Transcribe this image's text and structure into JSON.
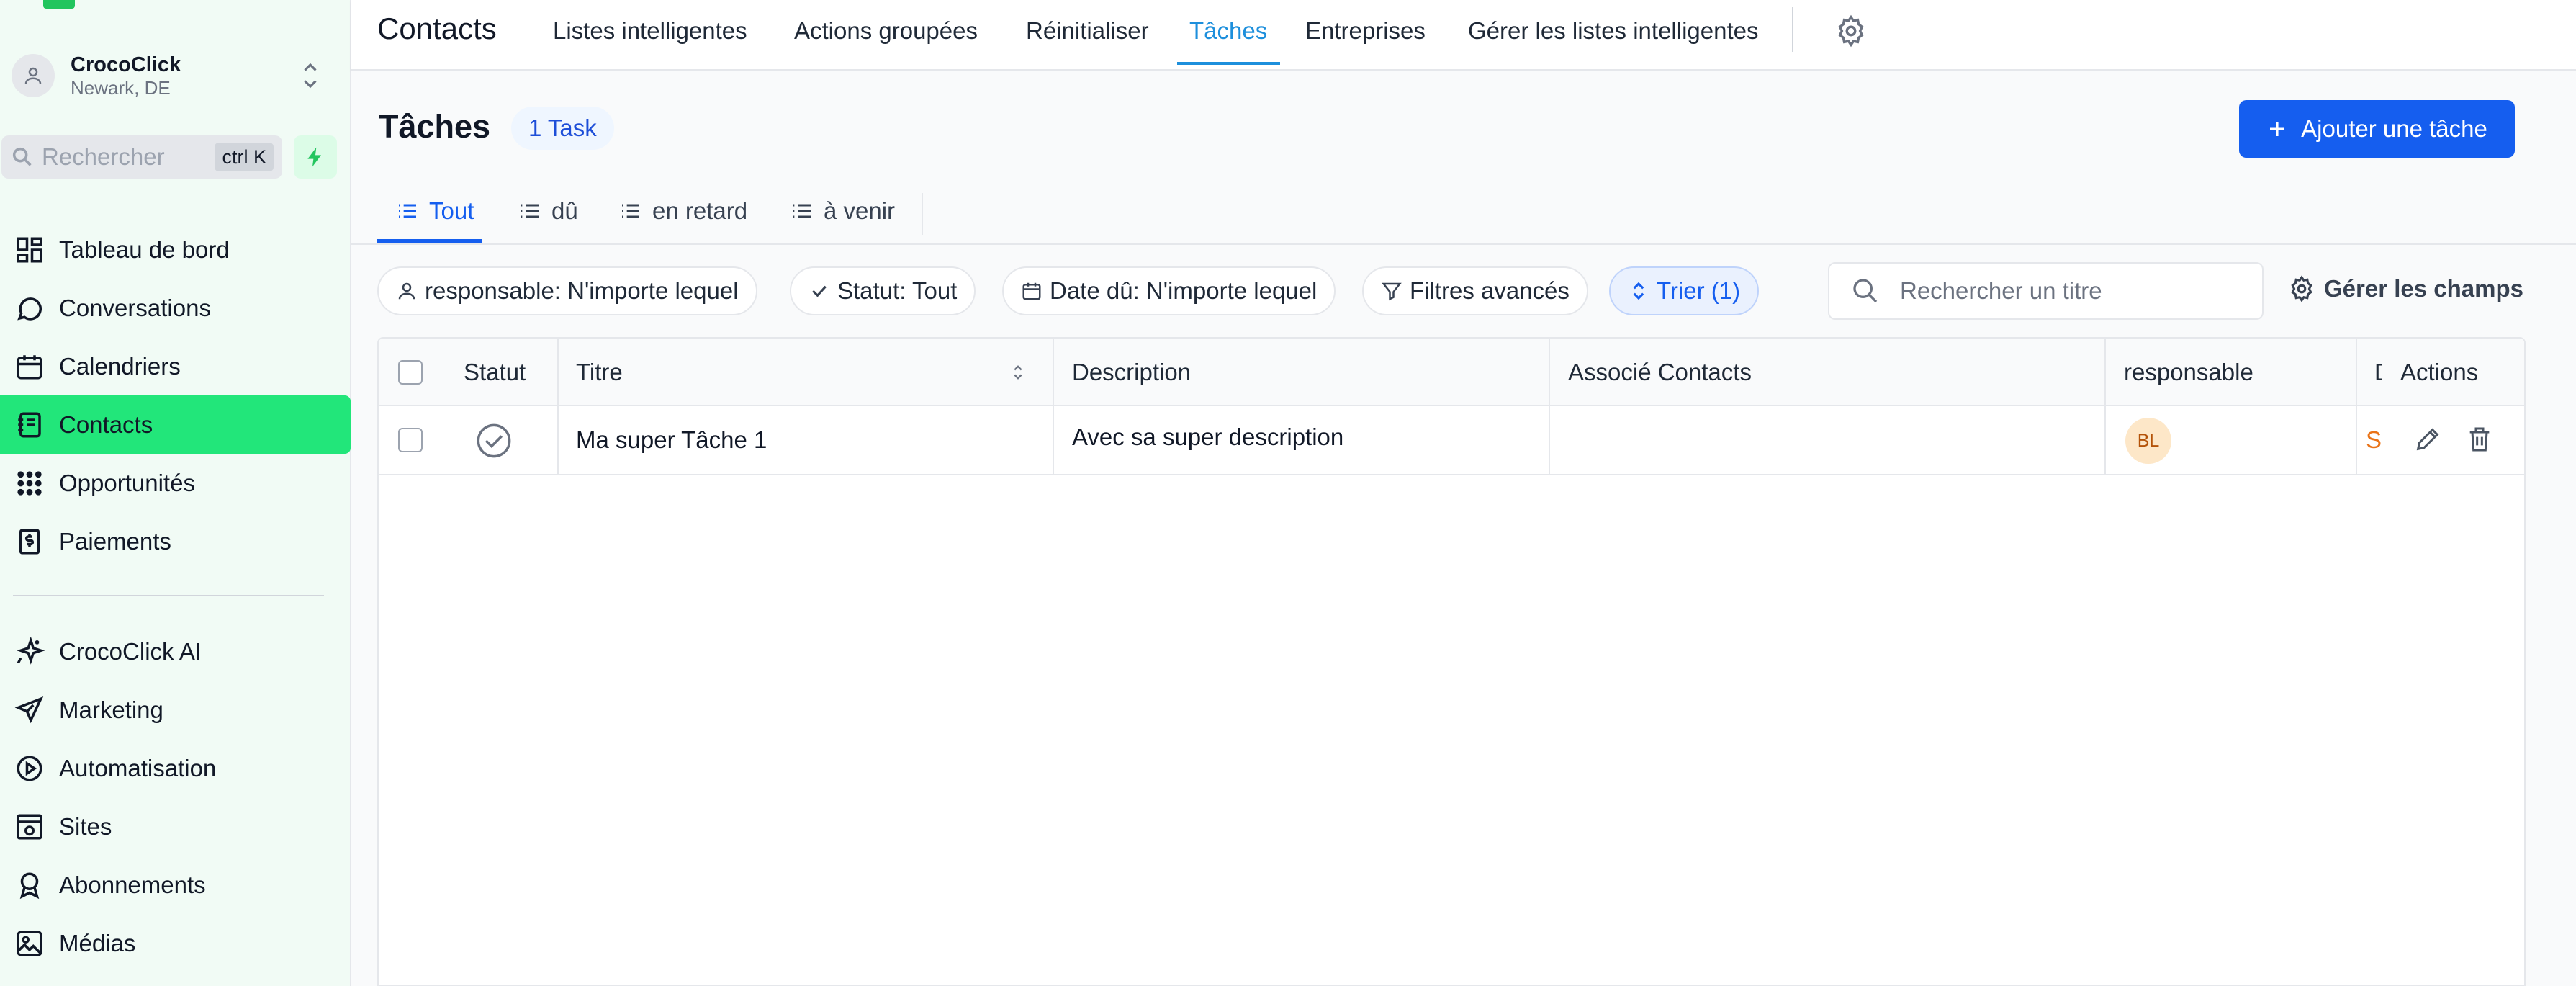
{
  "account": {
    "name": "CrocoClick",
    "location": "Newark, DE"
  },
  "search": {
    "placeholder": "Rechercher",
    "shortcut": "ctrl K"
  },
  "sidebar": {
    "primary": [
      {
        "label": "Tableau de bord",
        "icon": "dashboard-icon"
      },
      {
        "label": "Conversations",
        "icon": "chat-icon"
      },
      {
        "label": "Calendriers",
        "icon": "calendar-icon"
      },
      {
        "label": "Contacts",
        "icon": "contacts-icon",
        "active": true
      },
      {
        "label": "Opportunités",
        "icon": "opportunities-icon"
      },
      {
        "label": "Paiements",
        "icon": "payments-icon"
      }
    ],
    "secondary": [
      {
        "label": "CrocoClick AI",
        "icon": "sparkle-icon"
      },
      {
        "label": "Marketing",
        "icon": "send-icon"
      },
      {
        "label": "Automatisation",
        "icon": "automation-icon"
      },
      {
        "label": "Sites",
        "icon": "sites-icon"
      },
      {
        "label": "Abonnements",
        "icon": "badge-icon"
      },
      {
        "label": "Médias",
        "icon": "media-icon"
      }
    ]
  },
  "topnav": {
    "title": "Contacts",
    "links": [
      "Listes intelligentes",
      "Actions groupées",
      "Réinitialiser",
      "Tâches",
      "Entreprises",
      "Gérer les listes intelligentes"
    ],
    "active": "Tâches"
  },
  "page": {
    "title": "Tâches",
    "count": "1 Task",
    "add_button": "Ajouter une tâche"
  },
  "subtabs": [
    "Tout",
    "dû",
    "en retard",
    "à venir"
  ],
  "filters": {
    "assignee": "responsable: N'importe lequel",
    "status": "Statut: Tout",
    "due_date": "Date dû: N'importe lequel",
    "advanced": "Filtres avancés",
    "sort": "Trier (1)",
    "search_placeholder": "Rechercher un titre",
    "manage_fields": "Gérer les champs"
  },
  "table": {
    "headers": {
      "status": "Statut",
      "title": "Titre",
      "description": "Description",
      "contacts": "Associé Contacts",
      "assignee": "responsable",
      "actions": "Actions"
    },
    "rows": [
      {
        "title": "Ma super Tâche 1",
        "description": "Avec sa super description",
        "contacts": "",
        "assignee_initials": "BL",
        "due_letter": "S"
      }
    ]
  },
  "colors": {
    "primary": "#155eef",
    "active_nav": "#22e67a",
    "sidebar_bg": "#f1fbf5",
    "tab_active": "#1d8fdc"
  }
}
